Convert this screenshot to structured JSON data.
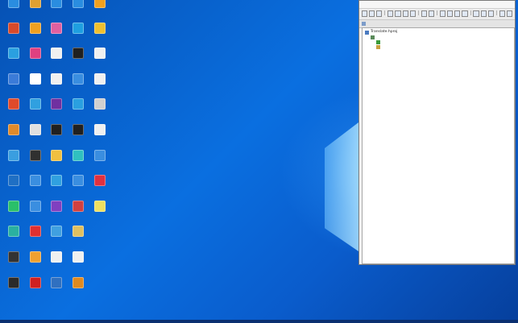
{
  "desktop": {
    "rows": 12,
    "icons": [
      {
        "name": "desktop-icon-c1-r1",
        "label": "",
        "color": "#2a8de0"
      },
      {
        "name": "desktop-icon-c1-r2",
        "label": "",
        "color": "#d84a2a"
      },
      {
        "name": "desktop-icon-c1-r3",
        "label": "",
        "color": "#2aa0e0"
      },
      {
        "name": "desktop-icon-c1-r4",
        "label": "",
        "color": "#3b7bd8"
      },
      {
        "name": "desktop-icon-c1-r5",
        "label": "",
        "color": "#e04a2a"
      },
      {
        "name": "desktop-icon-c1-r6",
        "label": "",
        "color": "#e08a2a"
      },
      {
        "name": "desktop-icon-c1-r7",
        "label": "",
        "color": "#3a9ee0"
      },
      {
        "name": "desktop-icon-c1-r8",
        "label": "",
        "color": "#1f6fc4"
      },
      {
        "name": "desktop-icon-c1-r9",
        "label": "",
        "color": "#2ac06a"
      },
      {
        "name": "desktop-icon-c1-r10",
        "label": "",
        "color": "#2ab0a0"
      },
      {
        "name": "desktop-icon-c1-r11",
        "label": "",
        "color": "#333333"
      },
      {
        "name": "desktop-icon-c1-r12",
        "label": "",
        "color": "#2a2a2a"
      },
      {
        "name": "desktop-icon-c2-r1",
        "label": "",
        "color": "#e0a030"
      },
      {
        "name": "desktop-icon-c2-r2",
        "label": "",
        "color": "#f0a020"
      },
      {
        "name": "desktop-icon-c2-r3",
        "label": "",
        "color": "#e04080"
      },
      {
        "name": "desktop-icon-c2-r4",
        "label": "",
        "color": "#ffffff"
      },
      {
        "name": "desktop-icon-c2-r5",
        "label": "",
        "color": "#30a0e0"
      },
      {
        "name": "desktop-icon-c2-r6",
        "label": "",
        "color": "#e0e0e0"
      },
      {
        "name": "desktop-icon-c2-r7",
        "label": "",
        "color": "#303030"
      },
      {
        "name": "desktop-icon-c2-r8",
        "label": "",
        "color": "#3a8ee0"
      },
      {
        "name": "desktop-icon-c2-r9",
        "label": "",
        "color": "#3a8ee0"
      },
      {
        "name": "desktop-icon-c2-r10",
        "label": "",
        "color": "#e03030"
      },
      {
        "name": "desktop-icon-c2-r11",
        "label": "",
        "color": "#f0a030"
      },
      {
        "name": "desktop-icon-c2-r12",
        "label": "",
        "color": "#d02020"
      },
      {
        "name": "desktop-icon-c3-r1",
        "label": "",
        "color": "#2a8de0"
      },
      {
        "name": "desktop-icon-c3-r2",
        "label": "",
        "color": "#e060a0"
      },
      {
        "name": "desktop-icon-c3-r3",
        "label": "",
        "color": "#f0f0f0"
      },
      {
        "name": "desktop-icon-c3-r4",
        "label": "",
        "color": "#f0f0f0"
      },
      {
        "name": "desktop-icon-c3-r5",
        "label": "",
        "color": "#7030a0"
      },
      {
        "name": "desktop-icon-c3-r6",
        "label": "",
        "color": "#202020"
      },
      {
        "name": "desktop-icon-c3-r7",
        "label": "",
        "color": "#f0c040"
      },
      {
        "name": "desktop-icon-c3-r8",
        "label": "",
        "color": "#30a0e0"
      },
      {
        "name": "desktop-icon-c3-r9",
        "label": "",
        "color": "#8040c0"
      },
      {
        "name": "desktop-icon-c3-r10",
        "label": "",
        "color": "#40a0e0"
      },
      {
        "name": "desktop-icon-c3-r11",
        "label": "",
        "color": "#f0f0f0"
      },
      {
        "name": "desktop-icon-c3-r12",
        "label": "",
        "color": "#3070c0"
      },
      {
        "name": "desktop-icon-c4-r1",
        "label": "",
        "color": "#2a8de0"
      },
      {
        "name": "desktop-icon-c4-r2",
        "label": "",
        "color": "#1f9fe0"
      },
      {
        "name": "desktop-icon-c4-r3",
        "label": "",
        "color": "#202020"
      },
      {
        "name": "desktop-icon-c4-r4",
        "label": "",
        "color": "#3a8ee0"
      },
      {
        "name": "desktop-icon-c4-r5",
        "label": "",
        "color": "#2aa0e0"
      },
      {
        "name": "desktop-icon-c4-r6",
        "label": "",
        "color": "#202020"
      },
      {
        "name": "desktop-icon-c4-r7",
        "label": "",
        "color": "#30c0c0"
      },
      {
        "name": "desktop-icon-c4-r8",
        "label": "",
        "color": "#3a8ee0"
      },
      {
        "name": "desktop-icon-c4-r9",
        "label": "",
        "color": "#d04040"
      },
      {
        "name": "desktop-icon-c4-r10",
        "label": "",
        "color": "#e0c060"
      },
      {
        "name": "desktop-icon-c4-r11",
        "label": "",
        "color": "#f0f0f0"
      },
      {
        "name": "desktop-icon-c4-r12",
        "label": "",
        "color": "#e08a20"
      },
      {
        "name": "desktop-icon-c5-r1",
        "label": "",
        "color": "#f0a020"
      },
      {
        "name": "desktop-icon-c5-r2",
        "label": "",
        "color": "#f0c030"
      },
      {
        "name": "desktop-icon-c5-r3",
        "label": "",
        "color": "#f0f0f0"
      },
      {
        "name": "desktop-icon-c5-r4",
        "label": "",
        "color": "#f0f0f0"
      },
      {
        "name": "desktop-icon-c5-r5",
        "label": "",
        "color": "#d0d0d0"
      },
      {
        "name": "desktop-icon-c5-r6",
        "label": "",
        "color": "#f0f0f0"
      },
      {
        "name": "desktop-icon-c5-r7",
        "label": "",
        "color": "#3a8ee0"
      },
      {
        "name": "desktop-icon-c5-r8",
        "label": "",
        "color": "#e03040"
      },
      {
        "name": "desktop-icon-c5-r9",
        "label": "",
        "color": "#f0e060"
      }
    ]
  },
  "app": {
    "menu": [
      "",
      "",
      "",
      "",
      "",
      "",
      "",
      "",
      ""
    ],
    "tab_label": "",
    "tree": {
      "root": "Translate.hproj",
      "child": "",
      "selected": "",
      "item": ""
    }
  }
}
